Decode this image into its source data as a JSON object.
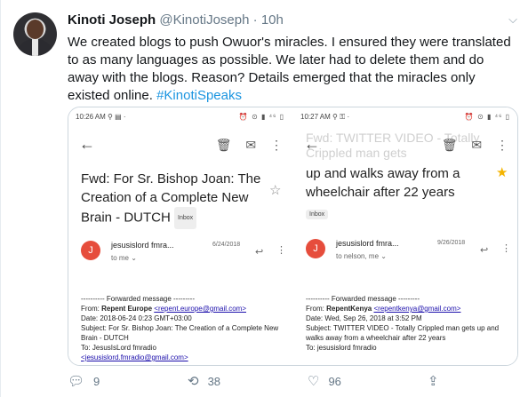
{
  "tweet": {
    "name": "Kinoti Joseph",
    "handle": "@KinotiJoseph",
    "separator": "·",
    "time": "10h",
    "body": "We created blogs to push Owuor's miracles. I ensured they were translated to as many languages as possible. We later had to delete them and do away with the blogs. Reason? Details emerged that the miracles only existed online.",
    "hashtag": "#KinotiSpeaks"
  },
  "left_shot": {
    "status_time": "10:26 AM",
    "status_right": "⏰ ⊙ ▮ ⁴⁶ ▯",
    "subject": "Fwd: For Sr. Bishop Joan: The Creation of a Complete New Brain - DUTCH",
    "badge": "Inbox",
    "sender_initial": "J",
    "sender": "jesusislord fmra...",
    "date": "6/24/2018",
    "to": "to me ⌄",
    "fwd_header": "---------- Forwarded message ---------",
    "from_label": "From:",
    "from_name": "Repent Europe",
    "from_email": "<repent.europe@gmail.com>",
    "date_line": "Date: 2018-06-24 0:23 GMT+03:00",
    "subject_line": "Subject: For Sr. Bishop Joan: The Creation of a Complete New Brain - DUTCH",
    "to_line": "To: JesusIsLord fmradio",
    "to_email": "<jesusislord.fmradio@gmail.com>"
  },
  "right_shot": {
    "status_time": "10:27 AM",
    "status_right": "⏰ ⊙ ▮ ⁴⁶ ▯",
    "ghost_subject": "Fwd: TWITTER VIDEO - Totally Crippled man gets",
    "subject": "up and walks away from a wheelchair after 22 years",
    "badge": "Inbox",
    "sender_initial": "J",
    "sender": "jesusislord fmra...",
    "date": "9/26/2018",
    "to": "to nelson, me ⌄",
    "fwd_header": "---------- Forwarded message ---------",
    "from_label": "From:",
    "from_name": "RepentKenya",
    "from_email": "<repentkenya@gmail.com>",
    "date_line": "Date: Wed, Sep 26, 2018 at 3:52 PM",
    "subject_line": "Subject: TWITTER VIDEO - Totally Crippled man gets up and walks away from a wheelchair after 22 years",
    "to_line": "To: jesusislord fmradio"
  },
  "actions": {
    "replies": "9",
    "retweets": "38",
    "likes": "96"
  },
  "colors": {
    "link": "#1b95e0",
    "sender_circle": "#e64d3c",
    "star": "#f4b400"
  }
}
